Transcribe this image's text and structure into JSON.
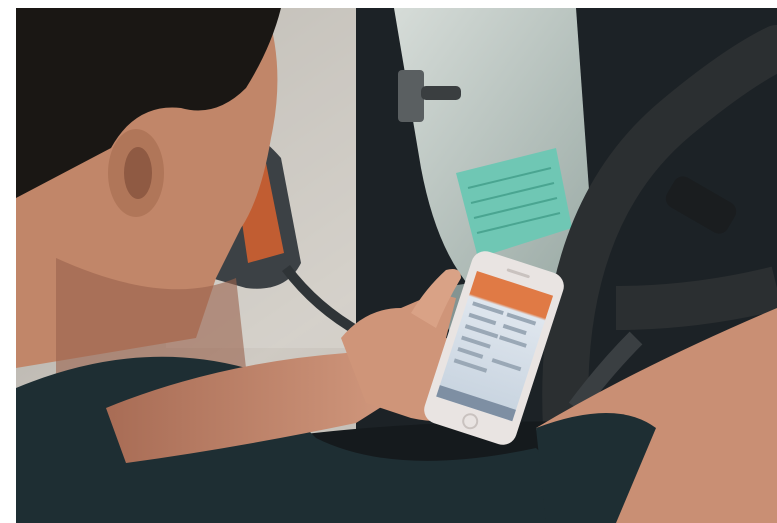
{
  "photo": {
    "subject": "driver-using-smartphone-in-truck-cab",
    "colors": {
      "cab_dark": "#1c2226",
      "window_glass": "#b9c4c0",
      "outside_blur": "#cfcac3",
      "sticker": "#6fc7b4",
      "skin": "#c98f74",
      "shirt": "#1e2e33",
      "hair": "#1a1714",
      "phone_body": "#e9e4e2",
      "phone_screen_header": "#e0703a",
      "phone_screen_body": "#dfe6ee",
      "steering_wheel": "#2b2f31",
      "mirror_orange": "#d8632f"
    }
  }
}
